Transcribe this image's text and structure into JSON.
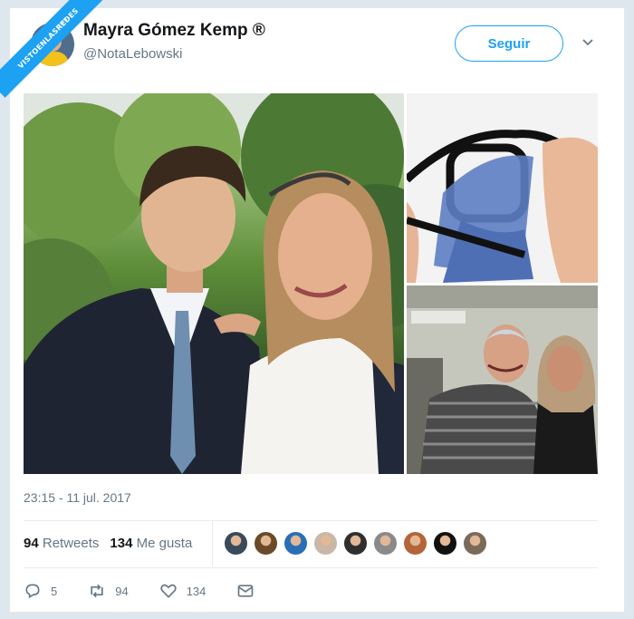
{
  "watermark": {
    "text": "VISTOENLASREDES",
    "sub": ".com"
  },
  "tweet": {
    "author_name": "Mayra Gómez Kemp ®",
    "author_handle": "@NotaLebowski",
    "follow_label": "Seguir",
    "timestamp": "23:15 - 11 jul. 2017"
  },
  "stats": {
    "retweets_count": "94",
    "retweets_label": "Retweets",
    "likes_count": "134",
    "likes_label": "Me gusta"
  },
  "actions": {
    "reply_count": "5",
    "retweet_count": "94",
    "like_count": "134"
  },
  "likers": [
    {
      "color": "#3a4a5a"
    },
    {
      "color": "#6b4a2a"
    },
    {
      "color": "#2a6fb5"
    },
    {
      "color": "#c8b8a8"
    },
    {
      "color": "#2f2f2f"
    },
    {
      "color": "#8a8a8a"
    },
    {
      "color": "#b5643a"
    },
    {
      "color": "#111111"
    },
    {
      "color": "#7a6a5a"
    }
  ],
  "colors": {
    "accent": "#1da1f2",
    "muted": "#657786"
  }
}
